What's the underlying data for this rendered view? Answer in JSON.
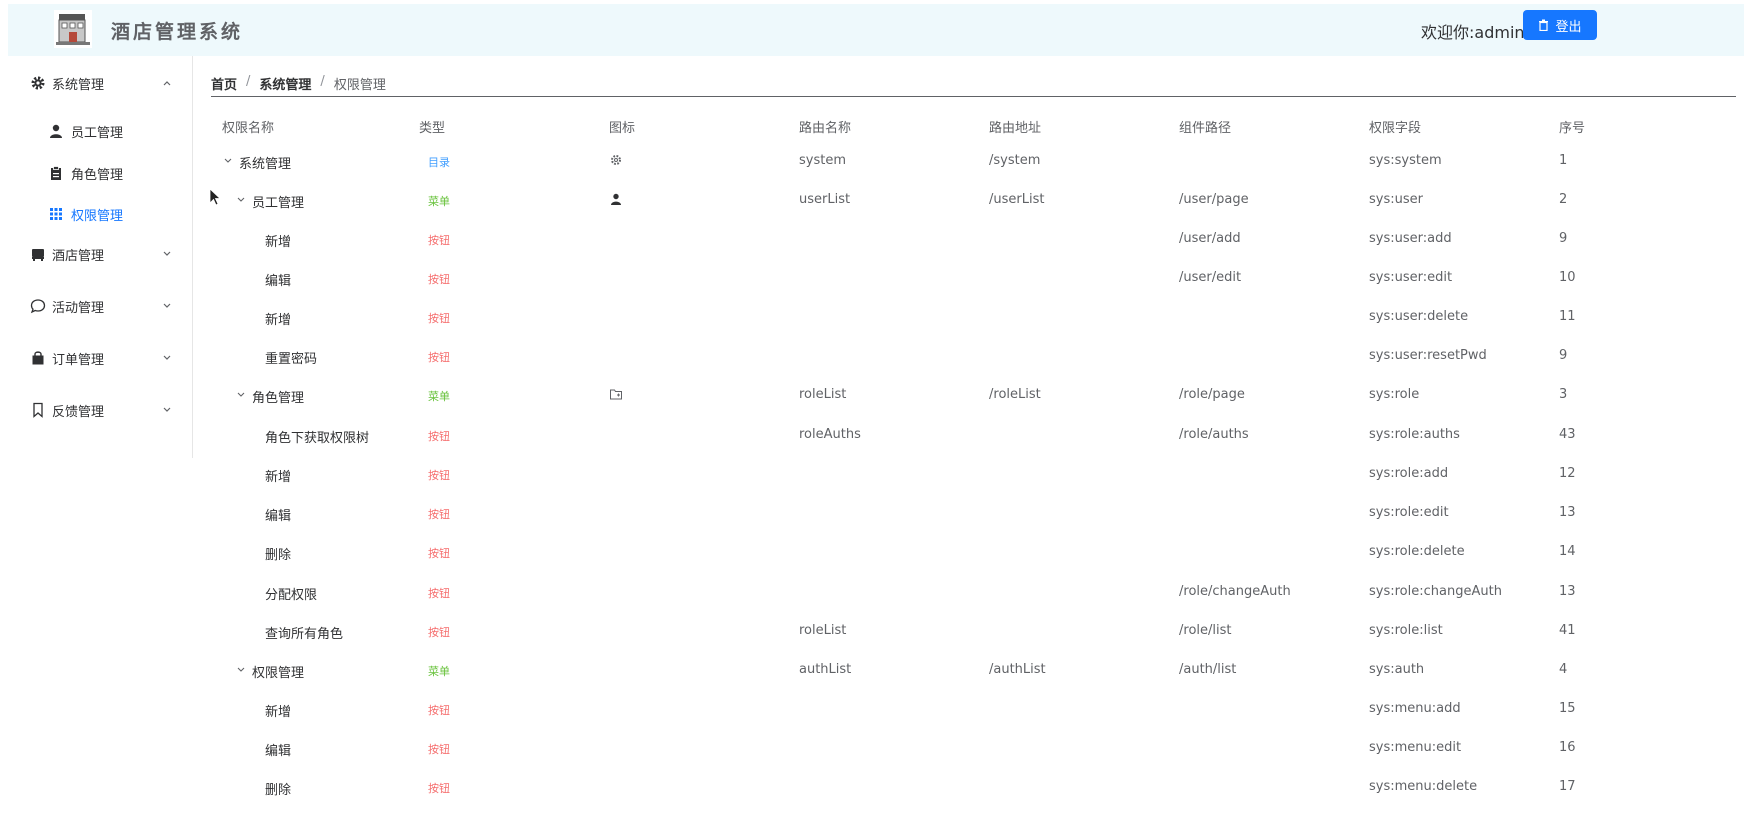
{
  "header": {
    "app_title": "酒店管理系统",
    "welcome": "欢迎你:admin",
    "logout_label": "登出"
  },
  "sidebar": {
    "items": [
      {
        "label": "系统管理",
        "icon": "gear-icon",
        "expanded": true
      },
      {
        "label": "员工管理",
        "icon": "user-icon"
      },
      {
        "label": "角色管理",
        "icon": "clipboard-icon"
      },
      {
        "label": "权限管理",
        "icon": "grid-icon",
        "active": true
      },
      {
        "label": "酒店管理",
        "icon": "hotel-icon"
      },
      {
        "label": "活动管理",
        "icon": "chat-icon"
      },
      {
        "label": "订单管理",
        "icon": "bag-icon"
      },
      {
        "label": "反馈管理",
        "icon": "bookmark-icon"
      }
    ]
  },
  "breadcrumb": {
    "home": "首页",
    "section": "系统管理",
    "current": "权限管理",
    "separator": "/"
  },
  "table": {
    "columns": [
      "权限名称",
      "类型",
      "图标",
      "路由名称",
      "路由地址",
      "组件路径",
      "权限字段",
      "序号"
    ],
    "rows": [
      {
        "name": "系统管理",
        "type": "目录",
        "icon": "gear-icon",
        "route_name": "system",
        "route_path": "/system",
        "component": "",
        "perm": "sys:system",
        "order": "1"
      },
      {
        "name": "员工管理",
        "type": "菜单",
        "icon": "user-icon",
        "route_name": "userList",
        "route_path": "/userList",
        "component": "/user/page",
        "perm": "sys:user",
        "order": "2"
      },
      {
        "name": "新增",
        "type": "按钮",
        "icon": "",
        "route_name": "",
        "route_path": "",
        "component": "/user/add",
        "perm": "sys:user:add",
        "order": "9"
      },
      {
        "name": "编辑",
        "type": "按钮",
        "icon": "",
        "route_name": "",
        "route_path": "",
        "component": "/user/edit",
        "perm": "sys:user:edit",
        "order": "10"
      },
      {
        "name": "新增",
        "type": "按钮",
        "icon": "",
        "route_name": "",
        "route_path": "",
        "component": "",
        "perm": "sys:user:delete",
        "order": "11"
      },
      {
        "name": "重置密码",
        "type": "按钮",
        "icon": "",
        "route_name": "",
        "route_path": "",
        "component": "",
        "perm": "sys:user:resetPwd",
        "order": "9"
      },
      {
        "name": "角色管理",
        "type": "菜单",
        "icon": "folder-icon",
        "route_name": "roleList",
        "route_path": "/roleList",
        "component": "/role/page",
        "perm": "sys:role",
        "order": "3"
      },
      {
        "name": "角色下获取权限树",
        "type": "按钮",
        "icon": "",
        "route_name": "roleAuths",
        "route_path": "",
        "component": "/role/auths",
        "perm": "sys:role:auths",
        "order": "43"
      },
      {
        "name": "新增",
        "type": "按钮",
        "icon": "",
        "route_name": "",
        "route_path": "",
        "component": "",
        "perm": "sys:role:add",
        "order": "12"
      },
      {
        "name": "编辑",
        "type": "按钮",
        "icon": "",
        "route_name": "",
        "route_path": "",
        "component": "",
        "perm": "sys:role:edit",
        "order": "13"
      },
      {
        "name": "删除",
        "type": "按钮",
        "icon": "",
        "route_name": "",
        "route_path": "",
        "component": "",
        "perm": "sys:role:delete",
        "order": "14"
      },
      {
        "name": "分配权限",
        "type": "按钮",
        "icon": "",
        "route_name": "",
        "route_path": "",
        "component": "/role/changeAuth",
        "perm": "sys:role:changeAuth",
        "order": "13"
      },
      {
        "name": "查询所有角色",
        "type": "按钮",
        "icon": "",
        "route_name": "roleList",
        "route_path": "",
        "component": "/role/list",
        "perm": "sys:role:list",
        "order": "41"
      },
      {
        "name": "权限管理",
        "type": "菜单",
        "icon": "",
        "route_name": "authList",
        "route_path": "/authList",
        "component": "/auth/list",
        "perm": "sys:auth",
        "order": "4"
      },
      {
        "name": "新增",
        "type": "按钮",
        "icon": "",
        "route_name": "",
        "route_path": "",
        "component": "",
        "perm": "sys:menu:add",
        "order": "15"
      },
      {
        "name": "编辑",
        "type": "按钮",
        "icon": "",
        "route_name": "",
        "route_path": "",
        "component": "",
        "perm": "sys:menu:edit",
        "order": "16"
      },
      {
        "name": "删除",
        "type": "按钮",
        "icon": "",
        "route_name": "",
        "route_path": "",
        "component": "",
        "perm": "sys:menu:delete",
        "order": "17"
      }
    ]
  },
  "colors": {
    "accent": "#1677ff",
    "header_bg": "#eef9fc",
    "tag_directory": "#409eff",
    "tag_menu": "#67c23a",
    "tag_button": "#f56c6c"
  }
}
